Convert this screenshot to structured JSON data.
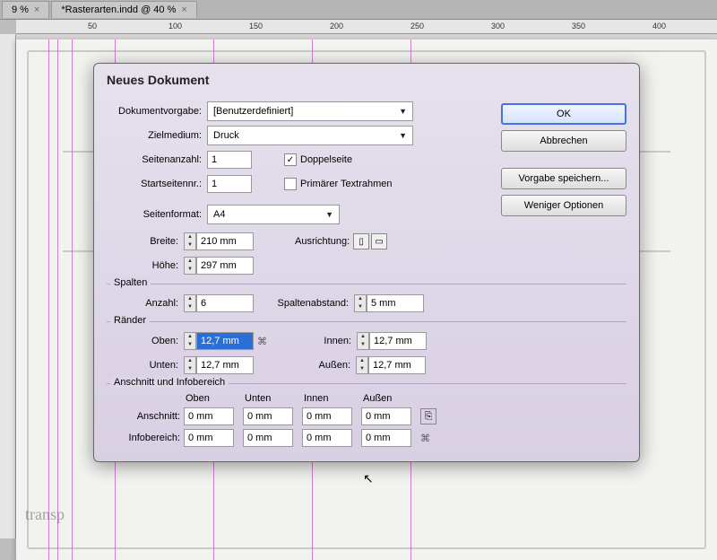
{
  "tabs": [
    {
      "label": "9 %",
      "close": "×"
    },
    {
      "label": "*Rasterarten.indd @ 40 %",
      "close": "×"
    }
  ],
  "ruler_marks": [
    "50",
    "100",
    "150",
    "200",
    "250",
    "300",
    "350",
    "400"
  ],
  "sketch_label": "transp",
  "dialog": {
    "title": "Neues Dokument",
    "preset_label": "Dokumentvorgabe:",
    "preset_value": "[Benutzerdefiniert]",
    "intent_label": "Zielmedium:",
    "intent_value": "Druck",
    "pages_label": "Seitenanzahl:",
    "pages_value": "1",
    "facing_label": "Doppelseite",
    "facing_checked": "✓",
    "startpage_label": "Startseitennr.:",
    "startpage_value": "1",
    "primary_label": "Primärer Textrahmen",
    "pagesize_label": "Seitenformat:",
    "pagesize_value": "A4",
    "width_label": "Breite:",
    "width_value": "210 mm",
    "height_label": "Höhe:",
    "height_value": "297 mm",
    "orientation_label": "Ausrichtung:",
    "columns": {
      "legend": "Spalten",
      "count_label": "Anzahl:",
      "count_value": "6",
      "gutter_label": "Spaltenabstand:",
      "gutter_value": "5 mm"
    },
    "margins": {
      "legend": "Ränder",
      "top_label": "Oben:",
      "top_value": "12,7 mm",
      "bottom_label": "Unten:",
      "bottom_value": "12,7 mm",
      "inside_label": "Innen:",
      "inside_value": "12,7 mm",
      "outside_label": "Außen:",
      "outside_value": "12,7 mm"
    },
    "bleed": {
      "legend": "Anschnitt und Infobereich",
      "col_top": "Oben",
      "col_bottom": "Unten",
      "col_inside": "Innen",
      "col_outside": "Außen",
      "bleed_label": "Anschnitt:",
      "bleed_top": "0 mm",
      "bleed_bottom": "0 mm",
      "bleed_inside": "0 mm",
      "bleed_outside": "0 mm",
      "slug_label": "Infobereich:",
      "slug_top": "0 mm",
      "slug_bottom": "0 mm",
      "slug_inside": "0 mm",
      "slug_outside": "0 mm"
    },
    "buttons": {
      "ok": "OK",
      "cancel": "Abbrechen",
      "save_preset": "Vorgabe speichern...",
      "fewer": "Weniger Optionen"
    }
  }
}
